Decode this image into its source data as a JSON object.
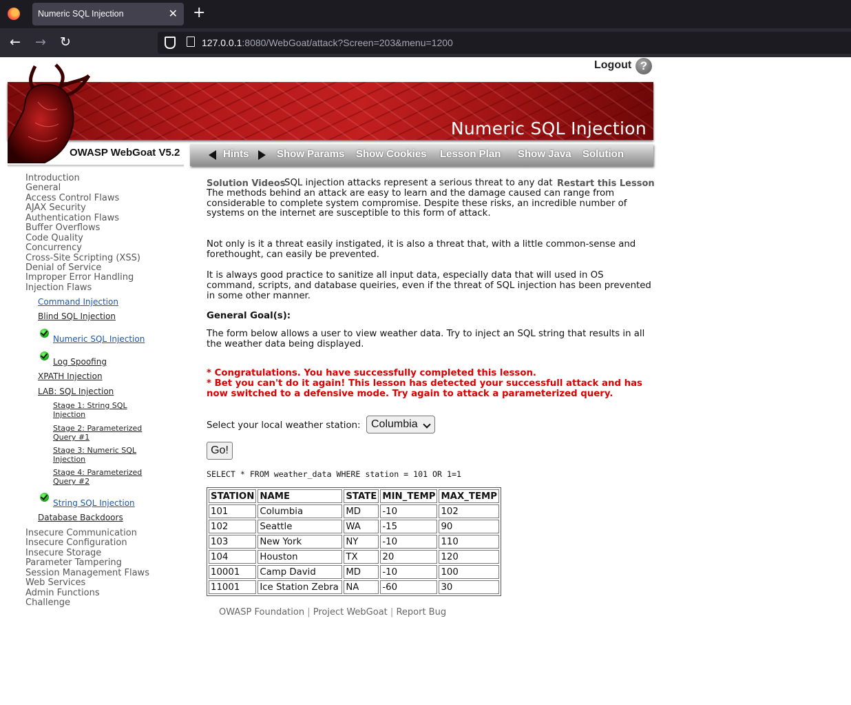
{
  "browser": {
    "tab_title": "Numeric SQL Injection",
    "tab_close": "✕",
    "new_tab": "+",
    "url_host": "127.0.0.1",
    "url_rest": ":8080/WebGoat/attack?Screen=203&menu=1200"
  },
  "header": {
    "logout": "Logout",
    "help": "?",
    "lesson_title": "Numeric SQL Injection",
    "product": "OWASP WebGoat V5.2"
  },
  "menubar": {
    "hints": "Hints",
    "show_params": "Show Params",
    "show_cookies": "Show Cookies",
    "lesson_plan": "Lesson Plan",
    "show_java": "Show Java",
    "solution": "Solution"
  },
  "nav": {
    "categories_top": [
      "Introduction",
      "General",
      "Access Control Flaws",
      "AJAX Security",
      "Authentication Flaws",
      "Buffer Overflows",
      "Code Quality",
      "Concurrency",
      "Cross-Site Scripting (XSS)",
      "Denial of Service",
      "Improper Error Handling",
      "Injection Flaws"
    ],
    "injection": {
      "command": "Command Injection",
      "blind": "Blind SQL Injection",
      "numeric": "Numeric SQL Injection",
      "log": "Log Spoofing",
      "xpath": "XPATH Injection",
      "lab": "LAB: SQL Injection",
      "stage1": "Stage 1: String SQL Injection",
      "stage2": "Stage 2: Parameterized Query #1",
      "stage3": "Stage 3: Numeric SQL Injection",
      "stage4": "Stage 4: Parameterized Query #2",
      "string": "String SQL Injection",
      "backdoors": "Database Backdoors"
    },
    "categories_bottom": [
      "Insecure Communication",
      "Insecure Configuration",
      "Insecure Storage",
      "Parameter Tampering",
      "Session Management Flaws",
      "Web Services",
      "Admin Functions",
      "Challenge"
    ]
  },
  "main": {
    "solution_videos": "Solution Videos",
    "restart": "Restart this Lesson",
    "intro": "SQL injection attacks represent a serious threat to any database-driven site. The methods behind an attack are easy to learn and the damage caused can range from considerable to complete system compromise. Despite these risks, an incredible number of systems on the internet are susceptible to this form of attack.",
    "para2": "Not only is it a threat easily instigated, it is also a threat that, with a little common-sense and forethought, can easily be prevented.",
    "para3": "It is always good practice to sanitize all input data, especially data that will used in OS command, scripts, and database queiries, even if the threat of SQL injection has been prevented in some other manner.",
    "goal_heading": "General Goal(s):",
    "goal_text": "The form below allows a user to view weather data. Try to inject an SQL string that results in all the weather data being displayed.",
    "congrats1": "* Congratulations. You have successfully completed this lesson.",
    "congrats2": "* Bet you can't do it again! This lesson has detected your successfull attack and has now switched to a defensive mode. Try again to attack a parameterized query.",
    "select_label": "Select your local weather station:",
    "select_value": "Columbia",
    "go": "Go!",
    "query": "SELECT * FROM weather_data WHERE station = 101 OR 1=1",
    "table": {
      "headers": [
        "STATION",
        "NAME",
        "STATE",
        "MIN_TEMP",
        "MAX_TEMP"
      ],
      "rows": [
        [
          "101",
          "Columbia",
          "MD",
          "-10",
          "102"
        ],
        [
          "102",
          "Seattle",
          "WA",
          "-15",
          "90"
        ],
        [
          "103",
          "New York",
          "NY",
          "-10",
          "110"
        ],
        [
          "104",
          "Houston",
          "TX",
          "20",
          "120"
        ],
        [
          "10001",
          "Camp David",
          "MD",
          "-10",
          "100"
        ],
        [
          "11001",
          "Ice Station Zebra",
          "NA",
          "-60",
          "30"
        ]
      ]
    }
  },
  "footer": {
    "owasp": "OWASP Foundation",
    "project": "Project WebGoat",
    "report": "Report Bug",
    "sep": "|"
  }
}
